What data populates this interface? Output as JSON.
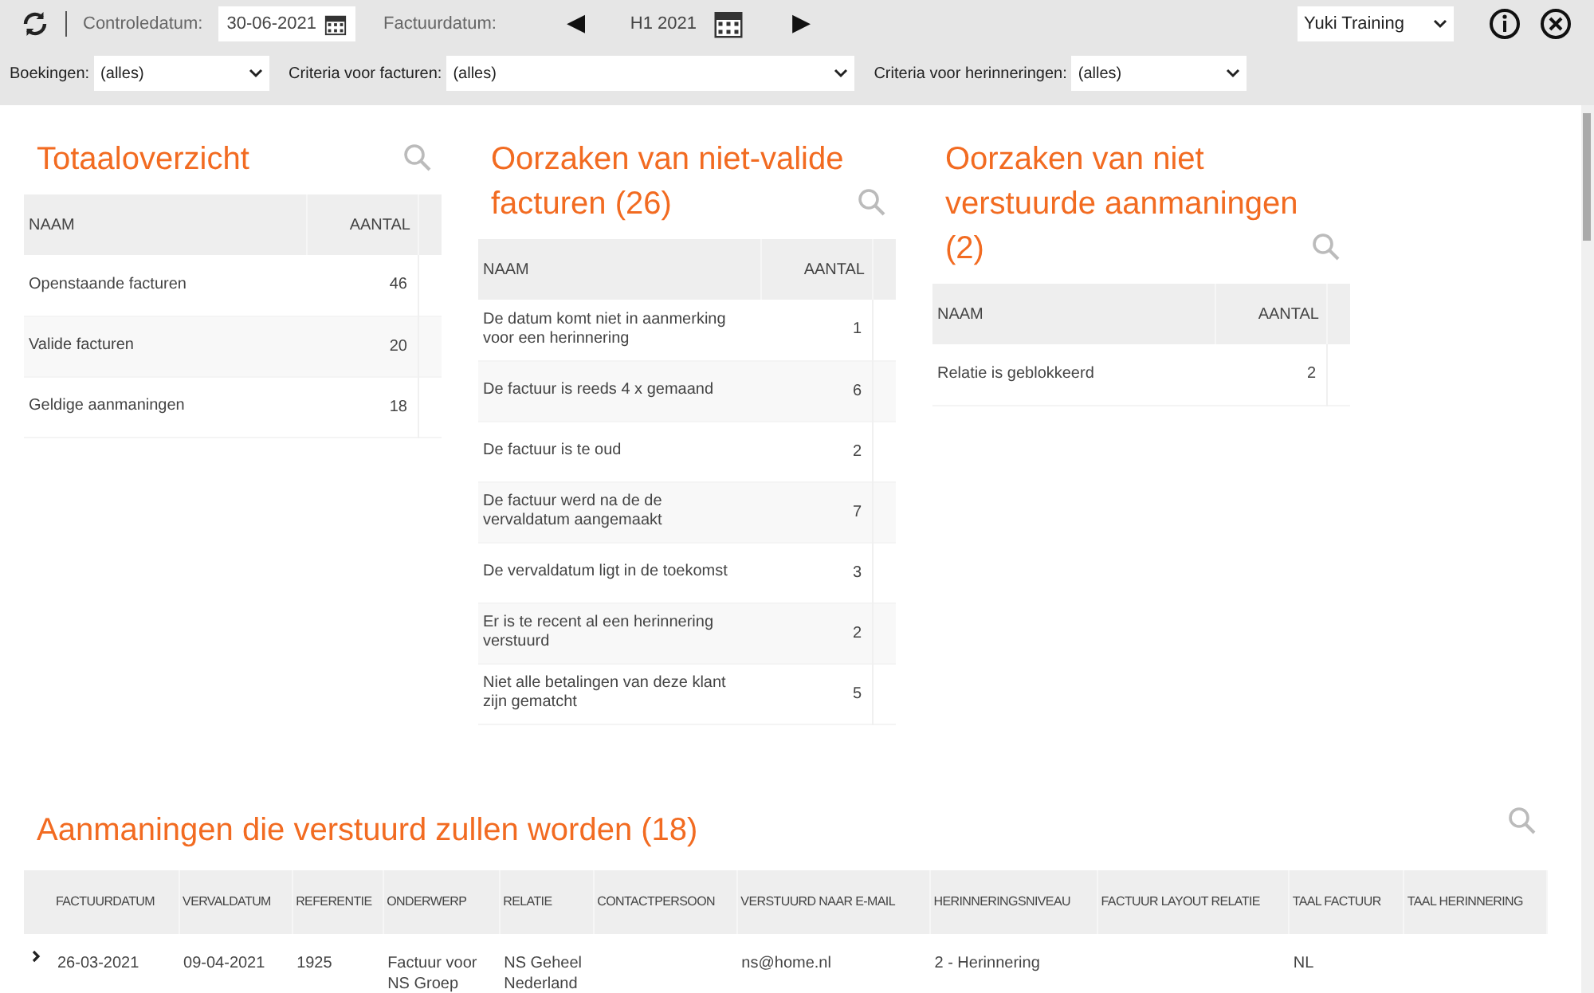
{
  "toolbar": {
    "controle_label": "Controledatum:",
    "controle_value": "30-06-2021",
    "factuur_label": "Factuurdatum:",
    "period": "H1 2021",
    "prev": "◀",
    "next": "▶",
    "company": "Yuki Training"
  },
  "filters": [
    {
      "label": "Boekingen:",
      "value": "(alles)"
    },
    {
      "label": "Criteria voor facturen:",
      "value": "(alles)"
    },
    {
      "label": "Criteria voor herinneringen:",
      "value": "(alles)"
    }
  ],
  "panels": [
    {
      "title": "Totaaloverzicht",
      "columns": [
        "NAAM",
        "AANTAL"
      ],
      "rows": [
        {
          "name": "Openstaande facturen",
          "count": "46"
        },
        {
          "name": "Valide facturen",
          "count": "20"
        },
        {
          "name": "Geldige aanmaningen",
          "count": "18"
        }
      ]
    },
    {
      "title": "Oorzaken van niet-valide facturen (26)",
      "columns": [
        "NAAM",
        "AANTAL"
      ],
      "rows": [
        {
          "name": "De datum komt niet in aanmerking voor een herinnering",
          "count": "1"
        },
        {
          "name": "De factuur is reeds 4 x gemaand",
          "count": "6"
        },
        {
          "name": "De factuur is te oud",
          "count": "2"
        },
        {
          "name": "De factuur werd na de de vervaldatum aangemaakt",
          "count": "7"
        },
        {
          "name": "De vervaldatum ligt in de toekomst",
          "count": "3"
        },
        {
          "name": "Er is te recent al een herinnering verstuurd",
          "count": "2"
        },
        {
          "name": "Niet alle betalingen van deze klant zijn gematcht",
          "count": "5"
        }
      ]
    },
    {
      "title": "Oorzaken van niet verstuurde aanmaningen (2)",
      "columns": [
        "NAAM",
        "AANTAL"
      ],
      "rows": [
        {
          "name": "Relatie is geblokkeerd",
          "count": "2"
        }
      ]
    }
  ],
  "reminders": {
    "title": "Aanmaningen die verstuurd zullen worden (18)",
    "columns": [
      "FACTUURDATUM",
      "VERVALDATUM",
      "REFERENTIE",
      "ONDERWERP",
      "RELATIE",
      "CONTACTPERSOON",
      "VERSTUURD NAAR E-MAIL",
      "HERINNERINGSNIVEAU",
      "FACTUUR LAYOUT RELATIE",
      "TAAL FACTUUR",
      "TAAL HERINNERING"
    ],
    "rows": [
      {
        "expanded": false,
        "cells": [
          "26-03-2021",
          "09-04-2021",
          "1925",
          "Factuur voor NS Groep",
          "NS Geheel Nederland",
          "",
          "ns@home.nl",
          "2 - Herinnering",
          "",
          "NL",
          ""
        ]
      }
    ]
  }
}
